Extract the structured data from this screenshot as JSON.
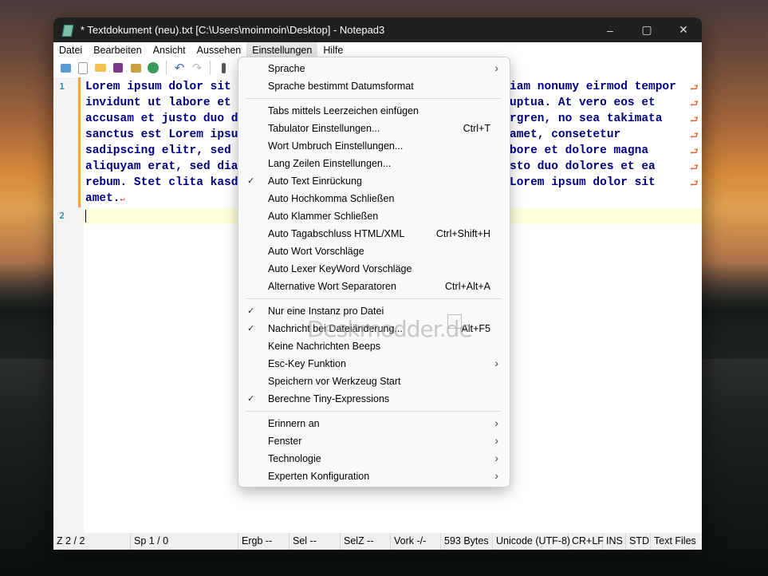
{
  "window": {
    "title": "* Textdokument (neu).txt [C:\\Users\\moinmoin\\Desktop] - Notepad3"
  },
  "menubar": [
    "Datei",
    "Bearbeiten",
    "Ansicht",
    "Aussehen",
    "Einstellungen",
    "Hilfe"
  ],
  "editor": {
    "lines": [
      "Lorem ipsum dolor sit",
      "invidunt ut labore et",
      "accusam et justo duo d",
      "sanctus est Lorem ipsu",
      "sadipscing elitr, sed",
      "aliquyam erat, sed dia",
      "rebum. Stet clita kasd",
      "amet."
    ],
    "lines_right": [
      "iam nonumy eirmod tempor",
      "uptua. At vero eos et",
      "rgren, no sea takimata",
      "amet, consetetur",
      "bore et dolore magna",
      "sto duo dolores et ea",
      "Lorem ipsum dolor sit",
      ""
    ],
    "line_numbers": [
      "1",
      "2"
    ],
    "eol_mark": "↵",
    "wrap_mark": "⮐"
  },
  "menu": {
    "items": [
      {
        "label": "Sprache",
        "accel": "",
        "check": false,
        "submenu": true
      },
      {
        "label": "Sprache bestimmt Datumsformat",
        "accel": "",
        "check": false,
        "submenu": false
      },
      {
        "label": "Tabs mittels Leerzeichen einfügen",
        "accel": "",
        "check": false,
        "submenu": false
      },
      {
        "label": "Tabulator Einstellungen...",
        "accel": "Ctrl+T",
        "check": false,
        "submenu": false
      },
      {
        "label": "Wort Umbruch Einstellungen...",
        "accel": "",
        "check": false,
        "submenu": false
      },
      {
        "label": "Lang Zeilen Einstellungen...",
        "accel": "",
        "check": false,
        "submenu": false
      },
      {
        "label": "Auto Text Einrückung",
        "accel": "",
        "check": true,
        "submenu": false
      },
      {
        "label": "Auto Hochkomma Schließen",
        "accel": "",
        "check": false,
        "submenu": false
      },
      {
        "label": "Auto Klammer Schließen",
        "accel": "",
        "check": false,
        "submenu": false
      },
      {
        "label": "Auto Tagabschluss HTML/XML",
        "accel": "Ctrl+Shift+H",
        "check": false,
        "submenu": false
      },
      {
        "label": "Auto Wort Vorschläge",
        "accel": "",
        "check": false,
        "submenu": false
      },
      {
        "label": "Auto Lexer KeyWord Vorschläge",
        "accel": "",
        "check": false,
        "submenu": false
      },
      {
        "label": "Alternative Wort Separatoren",
        "accel": "Ctrl+Alt+A",
        "check": false,
        "submenu": false
      },
      {
        "label": "Nur eine Instanz pro Datei",
        "accel": "",
        "check": true,
        "submenu": false
      },
      {
        "label": "Nachricht bei Dateiänderung...",
        "accel": "Alt+F5",
        "check": true,
        "submenu": false
      },
      {
        "label": "Keine Nachrichten Beeps",
        "accel": "",
        "check": false,
        "submenu": false
      },
      {
        "label": "Esc-Key Funktion",
        "accel": "",
        "check": false,
        "submenu": true
      },
      {
        "label": "Speichern vor Werkzeug Start",
        "accel": "",
        "check": false,
        "submenu": false
      },
      {
        "label": "Berechne Tiny-Expressions",
        "accel": "",
        "check": true,
        "submenu": false
      },
      {
        "label": "Erinnern an",
        "accel": "",
        "check": false,
        "submenu": true
      },
      {
        "label": "Fenster",
        "accel": "",
        "check": false,
        "submenu": true
      },
      {
        "label": "Technologie",
        "accel": "",
        "check": false,
        "submenu": true
      },
      {
        "label": "Experten Konfiguration",
        "accel": "",
        "check": false,
        "submenu": true
      }
    ],
    "check_glyph": "✓",
    "arrow_glyph": "›"
  },
  "watermark": "Deskmodder.de",
  "statusbar": [
    "Z  2 / 2",
    "Sp  1 / 0",
    "Ergb  --",
    "Sel  --",
    "SelZ  --",
    "Vork  -/-",
    "593 Bytes",
    "Unicode (UTF-8)",
    "CR+LF",
    "INS",
    "STD",
    "Text Files"
  ],
  "colors": {
    "accent_gutter": "#f0a050",
    "line_number": "#2b91af",
    "text": "#000080",
    "caret_line": "#ffffdd"
  }
}
